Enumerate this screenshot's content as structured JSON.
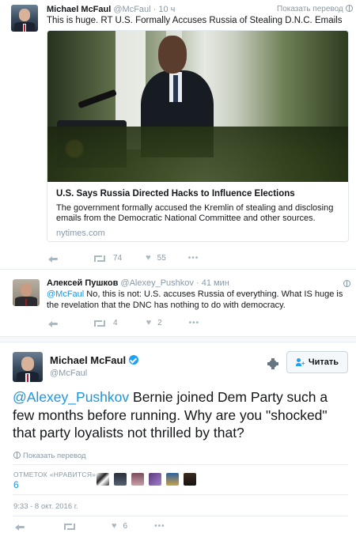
{
  "tweet1": {
    "name": "Michael McFaul",
    "handle": "@McFaul",
    "time": "10 ч",
    "translate": "Показать перевод",
    "text": "This is huge. RT U.S. Formally Accuses Russia of Stealing D.N.C. Emails",
    "card": {
      "title": "U.S. Says Russia Directed Hacks to Influence Elections",
      "description": "The government formally accused the Kremlin of stealing and disclosing emails from the Democratic National Committee and other sources.",
      "domain": "nytimes.com"
    },
    "retweets": "74",
    "likes": "55"
  },
  "tweet2": {
    "name": "Алексей Пушков",
    "handle": "@Alexey_Pushkov",
    "time": "41 мин",
    "mention": "@McFaul",
    "text": " No, this is not: U.S. accuses Russia of everything. What IS huge is the revelation that the DNC has nothing to do with democracy.",
    "retweets": "4",
    "likes": "2"
  },
  "main": {
    "name": "Michael McFaul",
    "handle": "@McFaul",
    "follow_label": "Читать",
    "mention": "@Alexey_Pushkov",
    "text": " Bernie joined Dem Party such a few months before running. Why are you \"shocked\" that party loyalists not thrilled by that?",
    "translate": "Показать перевод",
    "likes_label": "ОТМЕТОК «НРАВИТСЯ»",
    "likes_count": "6",
    "timestamp": "9:33 - 8 окт. 2016 г.",
    "likes_action": "6"
  },
  "colors": {
    "link": "#1b95e0",
    "verified": "#1da1f2",
    "muted": "#8899a6"
  }
}
